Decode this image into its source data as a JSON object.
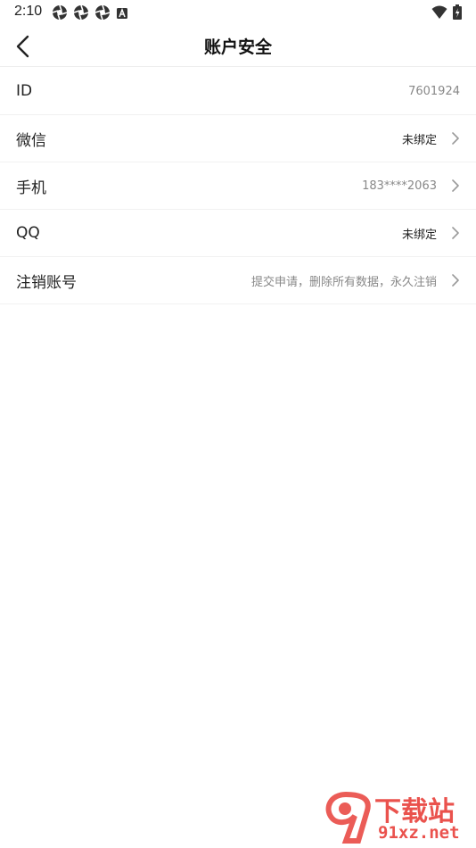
{
  "status_bar": {
    "time": "2:10",
    "left_icons": [
      "aperture-icon",
      "aperture-icon",
      "aperture-icon",
      "notification-a-icon"
    ],
    "right_icons": [
      "wifi-icon",
      "battery-charging-icon"
    ]
  },
  "header": {
    "title": "账户安全"
  },
  "rows": [
    {
      "label": "ID",
      "value": "7601924",
      "chevron": false
    },
    {
      "label": "微信",
      "value": "未绑定",
      "chevron": true
    },
    {
      "label": "手机",
      "value": "183****2063",
      "chevron": true
    },
    {
      "label": "QQ",
      "value": "未绑定",
      "chevron": true
    },
    {
      "label": "注销账号",
      "value": "提交申请，删除所有数据，永久注销",
      "chevron": true
    }
  ],
  "watermark": {
    "logo_text": "下载站",
    "site": "91xz.net"
  },
  "colors": {
    "background": "#ffffff",
    "text": "#222222",
    "muted": "#888888",
    "divider": "#f1f1f1",
    "watermark_red": "#e8403a"
  }
}
